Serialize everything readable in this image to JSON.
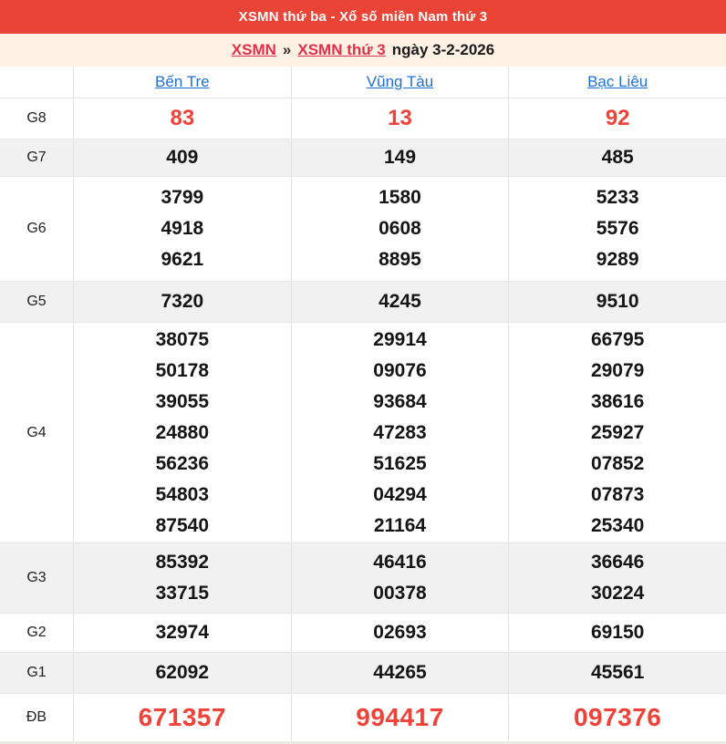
{
  "header": {
    "title": "XSMN thứ ba - Xổ số miền Nam thứ 3"
  },
  "breadcrumb": {
    "link1": "XSMN",
    "separator": "»",
    "link2": "XSMN thứ 3",
    "date_text": "ngày 3-2-2026"
  },
  "table": {
    "provinces": [
      "Bến Tre",
      "Vũng Tàu",
      "Bạc Liêu"
    ],
    "rows": [
      {
        "label": "G8",
        "emphasis": true,
        "big": false,
        "values": [
          [
            "83"
          ],
          [
            "13"
          ],
          [
            "92"
          ]
        ]
      },
      {
        "label": "G7",
        "emphasis": false,
        "big": false,
        "values": [
          [
            "409"
          ],
          [
            "149"
          ],
          [
            "485"
          ]
        ]
      },
      {
        "label": "G6",
        "emphasis": false,
        "big": false,
        "values": [
          [
            "3799",
            "4918",
            "9621"
          ],
          [
            "1580",
            "0608",
            "8895"
          ],
          [
            "5233",
            "5576",
            "9289"
          ]
        ]
      },
      {
        "label": "G5",
        "emphasis": false,
        "big": false,
        "values": [
          [
            "7320"
          ],
          [
            "4245"
          ],
          [
            "9510"
          ]
        ]
      },
      {
        "label": "G4",
        "emphasis": false,
        "big": false,
        "values": [
          [
            "38075",
            "50178",
            "39055",
            "24880",
            "56236",
            "54803",
            "87540"
          ],
          [
            "29914",
            "09076",
            "93684",
            "47283",
            "51625",
            "04294",
            "21164"
          ],
          [
            "66795",
            "29079",
            "38616",
            "25927",
            "07852",
            "07873",
            "25340"
          ]
        ]
      },
      {
        "label": "G3",
        "emphasis": false,
        "big": false,
        "values": [
          [
            "85392",
            "33715"
          ],
          [
            "46416",
            "00378"
          ],
          [
            "36646",
            "30224"
          ]
        ]
      },
      {
        "label": "G2",
        "emphasis": false,
        "big": false,
        "values": [
          [
            "32974"
          ],
          [
            "02693"
          ],
          [
            "69150"
          ]
        ]
      },
      {
        "label": "G1",
        "emphasis": false,
        "big": false,
        "values": [
          [
            "62092"
          ],
          [
            "44265"
          ],
          [
            "45561"
          ]
        ]
      },
      {
        "label": "ĐB",
        "emphasis": true,
        "big": true,
        "values": [
          [
            "671357"
          ],
          [
            "994417"
          ],
          [
            "097376"
          ]
        ]
      }
    ]
  },
  "colors": {
    "header_bg": "#e94435",
    "breadcrumb_bg": "#fdf2e4",
    "number_red": "#f04238",
    "link_blue": "#1e6fd9",
    "link_red": "#e62e4a",
    "shaded_row_bg": "#f1f1f1"
  }
}
